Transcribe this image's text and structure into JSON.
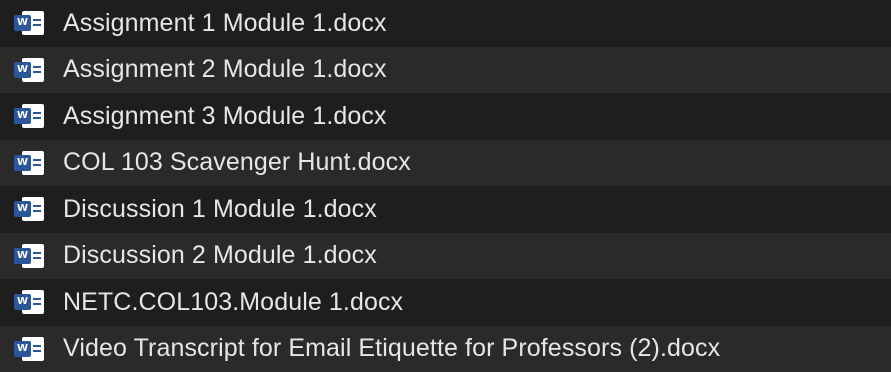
{
  "files": [
    {
      "name": "Assignment 1 Module 1.docx",
      "icon": "word-document-icon"
    },
    {
      "name": "Assignment 2 Module 1.docx",
      "icon": "word-document-icon"
    },
    {
      "name": "Assignment 3 Module 1.docx",
      "icon": "word-document-icon"
    },
    {
      "name": "COL 103 Scavenger Hunt.docx",
      "icon": "word-document-icon"
    },
    {
      "name": "Discussion 1 Module 1.docx",
      "icon": "word-document-icon"
    },
    {
      "name": "Discussion 2 Module 1.docx",
      "icon": "word-document-icon"
    },
    {
      "name": "NETC.COL103.Module 1.docx",
      "icon": "word-document-icon"
    },
    {
      "name": "Video Transcript for Email Etiquette for Professors (2).docx",
      "icon": "word-document-icon"
    }
  ],
  "icon_badge_letter": "W",
  "colors": {
    "background": "#1e1e1e",
    "alt_row": "#2a2a2a",
    "text": "#e6e6e6",
    "word_blue": "#2b579a"
  }
}
